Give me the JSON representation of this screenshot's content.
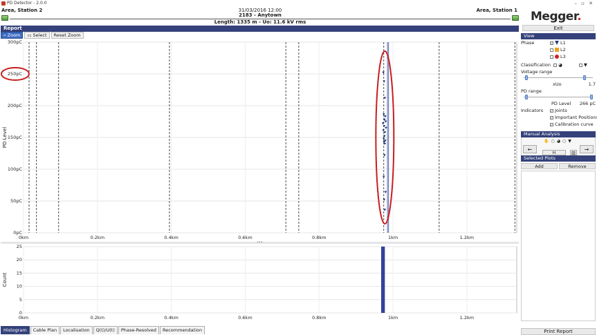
{
  "window": {
    "title": "PD Detector - 2.0.0",
    "controls": "– ▫ ✕"
  },
  "header": {
    "left_station": "Area, Station 2",
    "right_station": "Area, Station 1",
    "datetime": "31/03/2016 12:00",
    "cable_id": "2183 - Anytown",
    "info": "Length: 1335 m - Uo: 11.6 kV rms"
  },
  "brand": {
    "logo": "Megger",
    "logo_mark": "."
  },
  "exit_label": "Exit",
  "report": {
    "title": "Report",
    "toolbar": {
      "zoom": "Zoom",
      "select": "Select",
      "reset_zoom": "Reset Zoom"
    }
  },
  "chart_data": [
    {
      "type": "scatter",
      "ylabel": "PD Level",
      "xlabel": "",
      "ylim": [
        0,
        300
      ],
      "xlim": [
        0,
        1.335
      ],
      "yticks": [
        "300pC",
        "250pC",
        "200pC",
        "150pC",
        "100pC",
        "50pC",
        "0pC"
      ],
      "ytick_values": [
        300,
        250,
        200,
        150,
        100,
        50,
        0
      ],
      "xticks": [
        "0km",
        "0.2km",
        "0.4km",
        "0.6km",
        "0.8km",
        "1km",
        "1.2km"
      ],
      "xtick_values": [
        0,
        0.2,
        0.4,
        0.6,
        0.8,
        1.0,
        1.2
      ],
      "joints_km": [
        0.015,
        0.035,
        0.095,
        0.395,
        0.71,
        0.745,
        0.975,
        1.125,
        1.33
      ],
      "cluster_lines_km": [
        0.985,
        0.988
      ],
      "series": [
        {
          "x": [
            0.974,
            0.976,
            0.978,
            0.975,
            0.979,
            0.977,
            0.98,
            0.973,
            0.976,
            0.981,
            0.974,
            0.978,
            0.977,
            0.975,
            0.979,
            0.976,
            0.978,
            0.977,
            0.975,
            0.98,
            0.976,
            0.978
          ],
          "y": [
            252,
            238,
            212,
            186,
            183,
            178,
            175,
            172,
            168,
            165,
            161,
            158,
            152,
            148,
            145,
            143,
            140,
            122,
            88,
            64,
            52,
            36
          ]
        }
      ],
      "highlight_color": "#c81e1e",
      "marker_color": "#1a2a6c"
    },
    {
      "type": "bar",
      "ylabel": "Count",
      "xlabel": "",
      "ylim": [
        0,
        25
      ],
      "xlim": [
        0,
        1.335
      ],
      "yticks": [
        "25",
        "20",
        "15",
        "10",
        "5",
        "0"
      ],
      "ytick_values": [
        25,
        20,
        15,
        10,
        5,
        0
      ],
      "xticks": [
        "0km",
        "0.2km",
        "0.4km",
        "0.6km",
        "0.8km",
        "1km",
        "1.2km"
      ],
      "xtick_values": [
        0,
        0.2,
        0.4,
        0.6,
        0.8,
        1.0,
        1.2
      ],
      "bars": [
        {
          "x_start": 0.968,
          "x_end": 0.978,
          "count": 25
        }
      ],
      "bar_color": "#34419a"
    }
  ],
  "tabs": [
    {
      "label": "Histogram",
      "active": true
    },
    {
      "label": "Cable Plan",
      "active": false
    },
    {
      "label": "Localisation",
      "active": false
    },
    {
      "label": "Q(t)/U(t)",
      "active": false
    },
    {
      "label": "Phase-Resolved",
      "active": false
    },
    {
      "label": "Recommendation",
      "active": false
    }
  ],
  "view_panel": {
    "title": "View",
    "phase_label": "Phase",
    "phases": [
      {
        "label": "L1",
        "checked": true,
        "color": "#2a3a8c"
      },
      {
        "label": "L2",
        "checked": false,
        "color": "#f0a020"
      },
      {
        "label": "L3",
        "checked": false,
        "color": "#d02020"
      }
    ],
    "classification_label": "Classification",
    "voltage_range_label": "Voltage range",
    "voltage_unit": "xUo",
    "voltage_max": "1.7",
    "pd_range_label": "PD range",
    "pd_level_label": "PD Level",
    "pd_level_value": "266 pC",
    "indicators_label": "Indicators",
    "indicators": [
      {
        "label": "Joints",
        "checked": true
      },
      {
        "label": "Important Positions",
        "checked": true
      },
      {
        "label": "Calibration curve",
        "checked": true
      }
    ]
  },
  "manual_panel": {
    "title": "Manual Analysis",
    "h_label": "H",
    "left_arrow": "←",
    "right_arrow": "→"
  },
  "selected_panel": {
    "title": "Selected Plots",
    "add_label": "Add",
    "remove_label": "Remove"
  },
  "print_label": "Print Report"
}
